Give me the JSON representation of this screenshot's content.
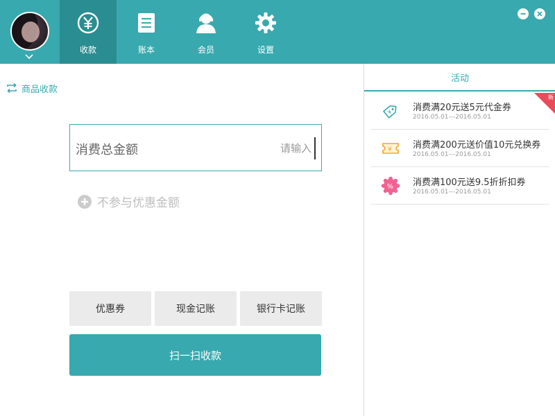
{
  "nav": {
    "items": [
      {
        "label": "收款",
        "icon": "yuan-icon",
        "active": true
      },
      {
        "label": "账本",
        "icon": "ledger-icon",
        "active": false
      },
      {
        "label": "会员",
        "icon": "member-icon",
        "active": false
      },
      {
        "label": "设置",
        "icon": "gear-icon",
        "active": false
      }
    ]
  },
  "breadcrumb": {
    "label": "商品收款"
  },
  "amount": {
    "label": "消费总金额",
    "placeholder": "请输入"
  },
  "discount": {
    "label": "不参与优惠金额"
  },
  "buttons": {
    "coupon": "优惠券",
    "cash": "现金记账",
    "bank_card": "银行卡记账",
    "scan": "扫一扫收款"
  },
  "activity": {
    "header": "活动",
    "new_badge": "新",
    "items": [
      {
        "title": "消费满20元送5元代金券",
        "date": "2016.05.01---2016.05.01",
        "icon": "tag-icon"
      },
      {
        "title": "消费满200元送价值10元兑换券",
        "date": "2016.05.01---2016.05.01",
        "icon": "ticket-icon"
      },
      {
        "title": "消费满100元送9.5折折扣券",
        "date": "2016.05.01---2016.05.01",
        "icon": "percent-badge-icon"
      }
    ]
  },
  "colors": {
    "accent": "#38a9ae",
    "accent_dark": "#2a8d91",
    "badge_red": "#e84c5a",
    "ticket_orange": "#f5a623",
    "percent_pink": "#f06292"
  }
}
